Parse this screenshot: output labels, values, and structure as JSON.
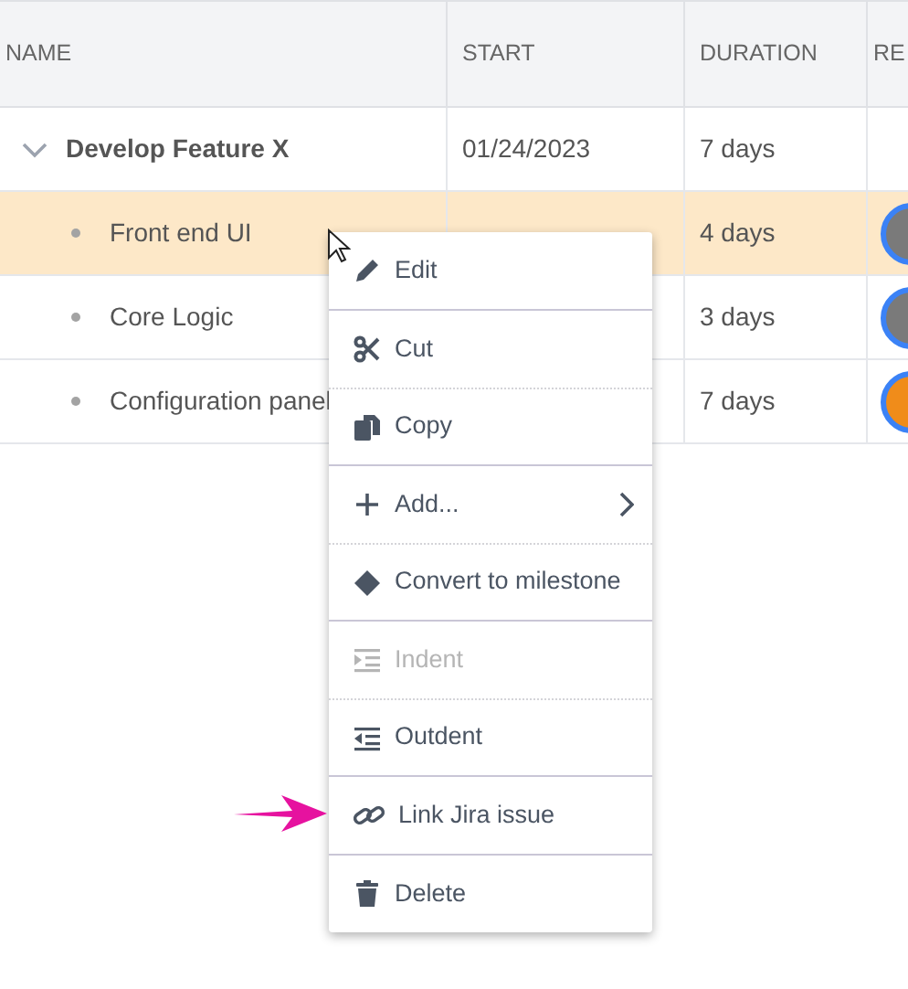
{
  "table": {
    "columns": [
      "NAME",
      "START",
      "DURATION",
      "RE"
    ],
    "rows": [
      {
        "name": "Develop Feature X",
        "start": "01/24/2023",
        "duration": "7 days",
        "expanded": true,
        "selected": false,
        "children": [
          {
            "name": "Front end UI",
            "duration": "4 days",
            "selected": true,
            "avatar": {
              "color": "#7a7a7a"
            }
          },
          {
            "name": "Core Logic",
            "duration": "3 days",
            "selected": false,
            "avatar": {
              "color": "#7a7a7a"
            }
          },
          {
            "name": "Configuration panel",
            "duration": "7 days",
            "selected": false,
            "avatar": {
              "color": "#f08c1a"
            }
          }
        ]
      }
    ]
  },
  "context_menu": {
    "groups": [
      [
        {
          "label": "Edit",
          "disabled": false,
          "submenu": false
        }
      ],
      [
        {
          "label": "Cut",
          "disabled": false,
          "submenu": false
        },
        {
          "label": "Copy",
          "disabled": false,
          "submenu": false
        }
      ],
      [
        {
          "label": "Add...",
          "disabled": false,
          "submenu": true
        },
        {
          "label": "Convert to milestone",
          "disabled": false,
          "submenu": false
        }
      ],
      [
        {
          "label": "Indent",
          "disabled": true,
          "submenu": false
        },
        {
          "label": "Outdent",
          "disabled": false,
          "submenu": false
        }
      ],
      [
        {
          "label": "Link Jira issue",
          "disabled": false,
          "submenu": false
        }
      ],
      [
        {
          "label": "Delete",
          "disabled": false,
          "submenu": false
        }
      ]
    ]
  }
}
